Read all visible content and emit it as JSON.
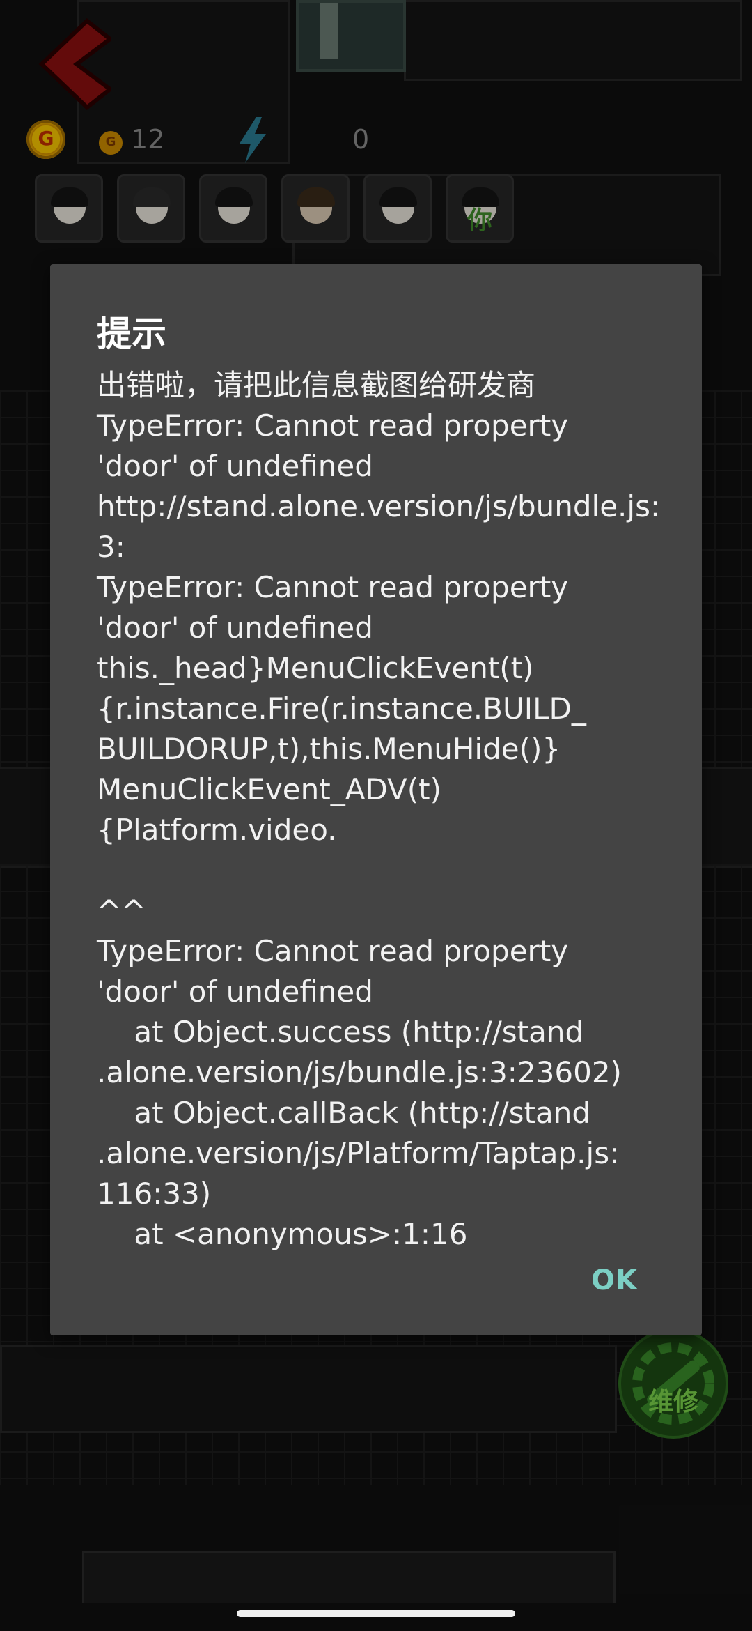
{
  "hud": {
    "coin_symbol": "G",
    "coins": "12",
    "energy": "0"
  },
  "avatars": [
    {
      "name": "worker-1"
    },
    {
      "name": "worker-2"
    },
    {
      "name": "worker-3"
    },
    {
      "name": "worker-4"
    },
    {
      "name": "worker-5"
    },
    {
      "name": "worker-6",
      "tag": "你"
    }
  ],
  "repair_button": {
    "label": "维修"
  },
  "dialog": {
    "title": "提示",
    "message": "出错啦，请把此信息截图给研发商\nTypeError: Cannot read property\n'door' of undefined\nhttp://stand.alone.version/js/bundle.js:\n3:\nTypeError: Cannot read property\n'door' of undefined\nthis._head}MenuClickEvent(t)\n{r.instance.Fire(r.instance.BUILD_\nBUILDORUP,t),this.MenuHide()}\nMenuClickEvent_ADV(t)\n{Platform.video.\n                                                                ^^\nTypeError: Cannot read property\n'door' of undefined\n    at Object.success (http://stand\n.alone.version/js/bundle.js:3:23602)\n    at Object.callBack (http://stand\n.alone.version/js/Platform/Taptap.js:\n116:33)\n    at <anonymous>:1:16",
    "ok_label": "OK"
  },
  "colors": {
    "dialog_bg": "#444444",
    "accent": "#7ccfc4"
  }
}
